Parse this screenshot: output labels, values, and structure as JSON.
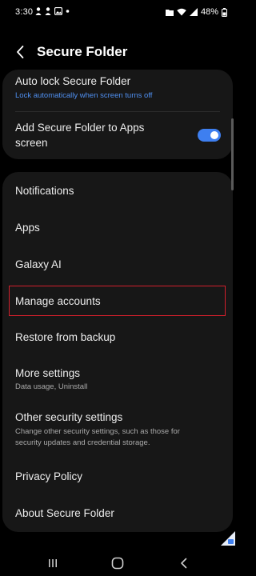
{
  "status_bar": {
    "time": "3:30",
    "battery": "48%"
  },
  "header": {
    "title": "Secure Folder"
  },
  "top_card": {
    "auto_lock": {
      "title": "Auto lock Secure Folder",
      "subtitle": "Lock automatically when screen turns off"
    },
    "add_to_apps": {
      "title_line1": "Add Secure Folder to Apps",
      "title_line2": "screen",
      "toggle_on": true
    }
  },
  "main_card": {
    "items": [
      {
        "title": "Notifications"
      },
      {
        "title": "Apps"
      },
      {
        "title": "Galaxy AI"
      },
      {
        "title": "Manage accounts"
      },
      {
        "title": "Restore from backup"
      },
      {
        "title": "More settings",
        "subtitle": "Data usage, Uninstall"
      },
      {
        "title": "Other security settings",
        "subtitle_line1": "Change other security settings, such as those for",
        "subtitle_line2": "security updates and credential storage."
      },
      {
        "title": "Privacy Policy"
      },
      {
        "title": "About Secure Folder"
      }
    ],
    "highlighted_item": "Manage accounts"
  },
  "colors": {
    "background": "#000000",
    "card": "#171717",
    "accent": "#4f8ff0",
    "toggle": "#3e7ff0",
    "highlight": "#d21f2b"
  },
  "icons": {
    "back": "chevron-left-icon",
    "nav_recents": "recents-icon",
    "nav_home": "home-icon",
    "nav_back": "back-icon"
  }
}
